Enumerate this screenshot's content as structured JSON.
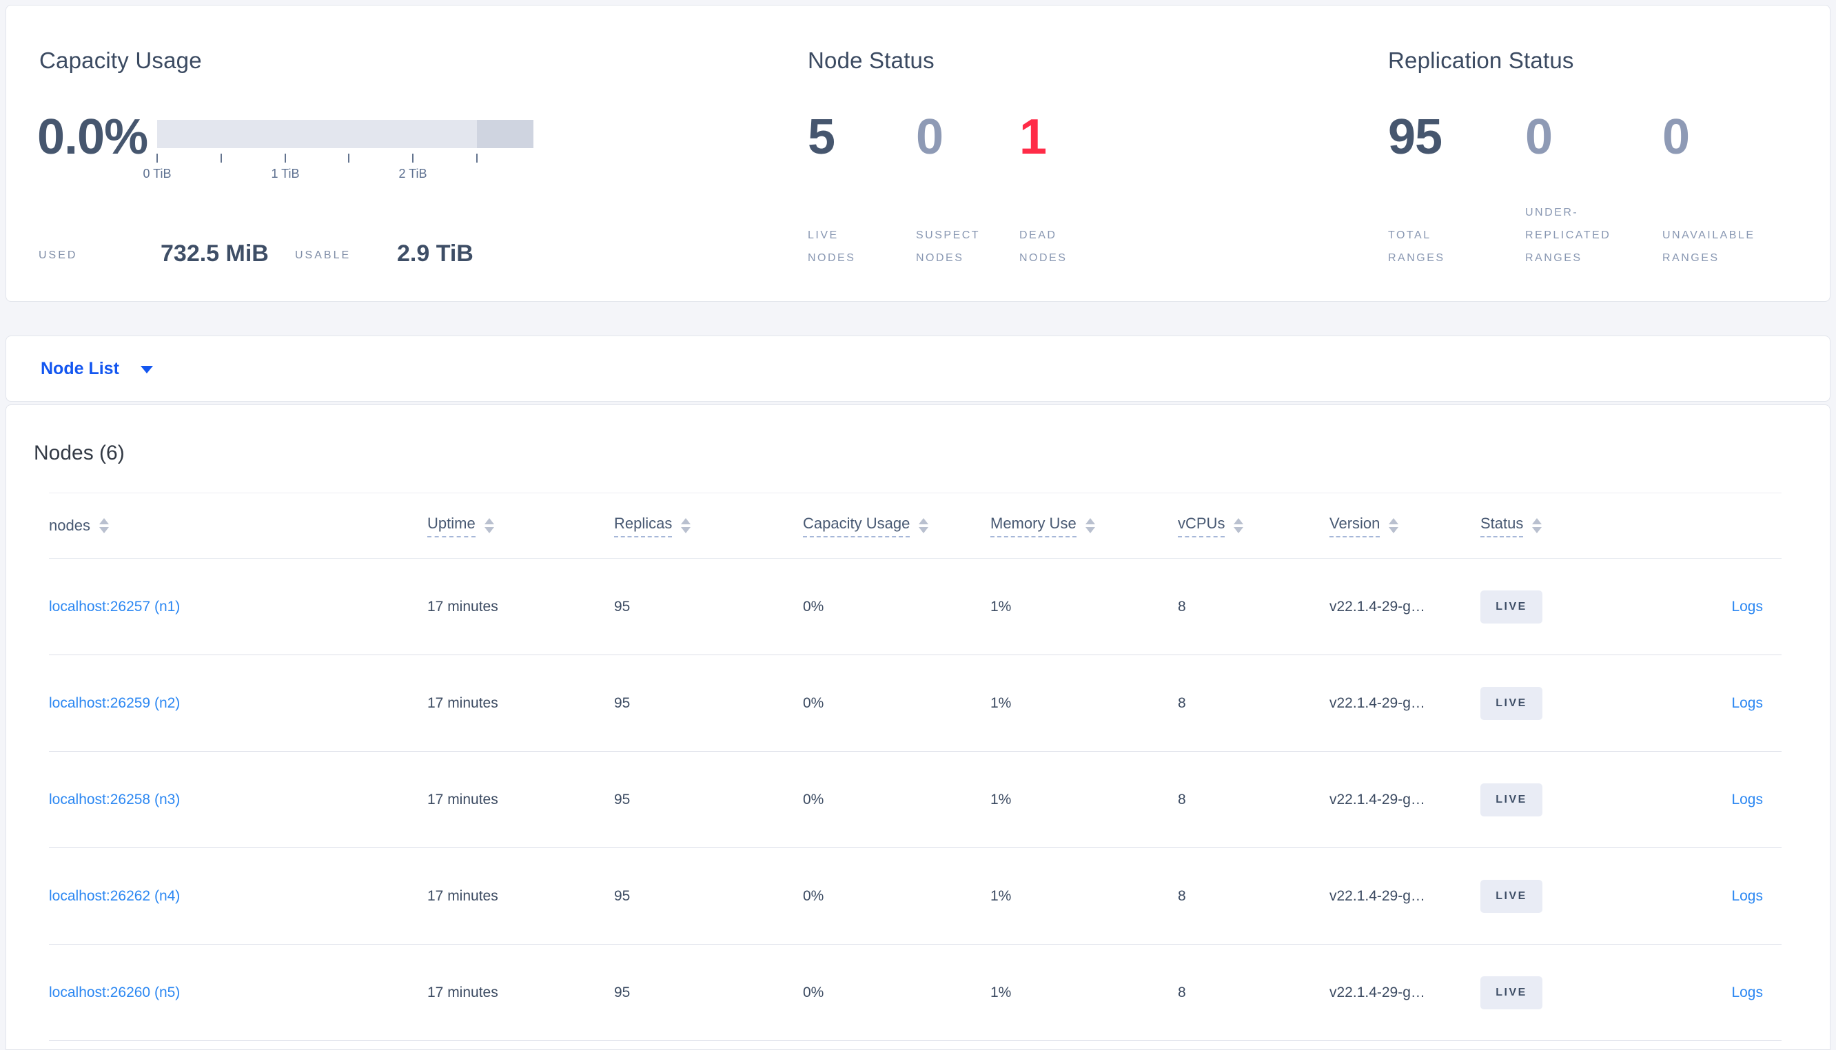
{
  "overview": {
    "capacity": {
      "title": "Capacity Usage",
      "percent": "0.0%",
      "tick_labels": [
        "0 TiB",
        "1 TiB",
        "2 TiB"
      ],
      "used_label": "USED",
      "used_value": "732.5 MiB",
      "usable_label": "USABLE",
      "usable_value": "2.9 TiB"
    },
    "node_status": {
      "title": "Node Status",
      "metrics": [
        {
          "value": "5",
          "line1": "LIVE",
          "line2": "NODES"
        },
        {
          "value": "0",
          "line1": "SUSPECT",
          "line2": "NODES"
        },
        {
          "value": "1",
          "line1": "DEAD",
          "line2": "NODES"
        }
      ]
    },
    "replication": {
      "title": "Replication Status",
      "metrics": [
        {
          "value": "95",
          "line1": "TOTAL",
          "line2": "RANGES"
        },
        {
          "value": "0",
          "line0": "UNDER-",
          "line1": "REPLICATED",
          "line2": "RANGES"
        },
        {
          "value": "0",
          "line1": "UNAVAILABLE",
          "line2": "RANGES"
        }
      ]
    }
  },
  "view_selector": {
    "label": "Node List"
  },
  "nodes_section": {
    "title": "Nodes (6)",
    "columns": [
      "nodes",
      "Uptime",
      "Replicas",
      "Capacity Usage",
      "Memory Use",
      "vCPUs",
      "Version",
      "Status"
    ],
    "rows": [
      {
        "node": "localhost:26257 (n1)",
        "uptime": "17 minutes",
        "replicas": "95",
        "capacity": "0%",
        "memory": "1%",
        "vcpus": "8",
        "version": "v22.1.4-29-g…",
        "status": "LIVE",
        "logs": "Logs"
      },
      {
        "node": "localhost:26259 (n2)",
        "uptime": "17 minutes",
        "replicas": "95",
        "capacity": "0%",
        "memory": "1%",
        "vcpus": "8",
        "version": "v22.1.4-29-g…",
        "status": "LIVE",
        "logs": "Logs"
      },
      {
        "node": "localhost:26258 (n3)",
        "uptime": "17 minutes",
        "replicas": "95",
        "capacity": "0%",
        "memory": "1%",
        "vcpus": "8",
        "version": "v22.1.4-29-g…",
        "status": "LIVE",
        "logs": "Logs"
      },
      {
        "node": "localhost:26262 (n4)",
        "uptime": "17 minutes",
        "replicas": "95",
        "capacity": "0%",
        "memory": "1%",
        "vcpus": "8",
        "version": "v22.1.4-29-g…",
        "status": "LIVE",
        "logs": "Logs"
      },
      {
        "node": "localhost:26260 (n5)",
        "uptime": "17 minutes",
        "replicas": "95",
        "capacity": "0%",
        "memory": "1%",
        "vcpus": "8",
        "version": "v22.1.4-29-g…",
        "status": "LIVE",
        "logs": "Logs"
      }
    ]
  },
  "colors": {
    "selector_blue": "#1356f0",
    "link_blue": "#2b87f2",
    "danger_red": "#ff2b47",
    "muted_number": "#8e9ab5",
    "dark_number": "#46566e",
    "page_background": "#f4f5f9"
  }
}
